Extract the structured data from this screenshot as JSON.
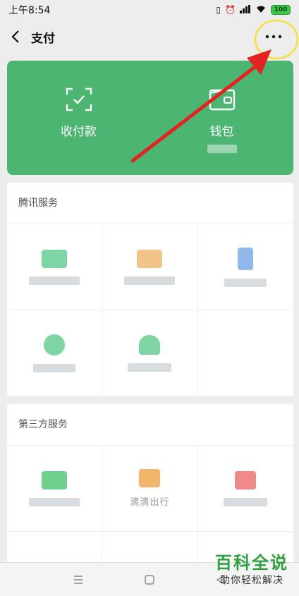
{
  "status_bar": {
    "time": "上午8:54",
    "battery": "100"
  },
  "nav": {
    "title": "支付"
  },
  "pay_card": {
    "collect_label": "收付款",
    "wallet_label": "钱包"
  },
  "tencent_services": {
    "title": "腾讯服务",
    "items": [
      {
        "icon_color": "#7fd4a3"
      },
      {
        "icon_color": "#f2c48a"
      },
      {
        "icon_color": "#8fb9e8"
      },
      {
        "icon_color": "#7fd4a3"
      },
      {
        "icon_color": "#7fd4a3"
      }
    ]
  },
  "third_party_services": {
    "title": "第三方服务",
    "items": [
      {
        "icon_color": "#6fcf8f",
        "caption": ""
      },
      {
        "icon_color": "#f2b66a",
        "caption": "滴滴出行"
      },
      {
        "icon_color": "#f08a8a",
        "caption": ""
      }
    ]
  },
  "watermark": {
    "main": "百科全说",
    "sub": "助你轻松解决"
  },
  "colors": {
    "brand_green": "#4cb572",
    "annotation_red": "#e52222",
    "annotation_yellow": "#f5e03a"
  }
}
